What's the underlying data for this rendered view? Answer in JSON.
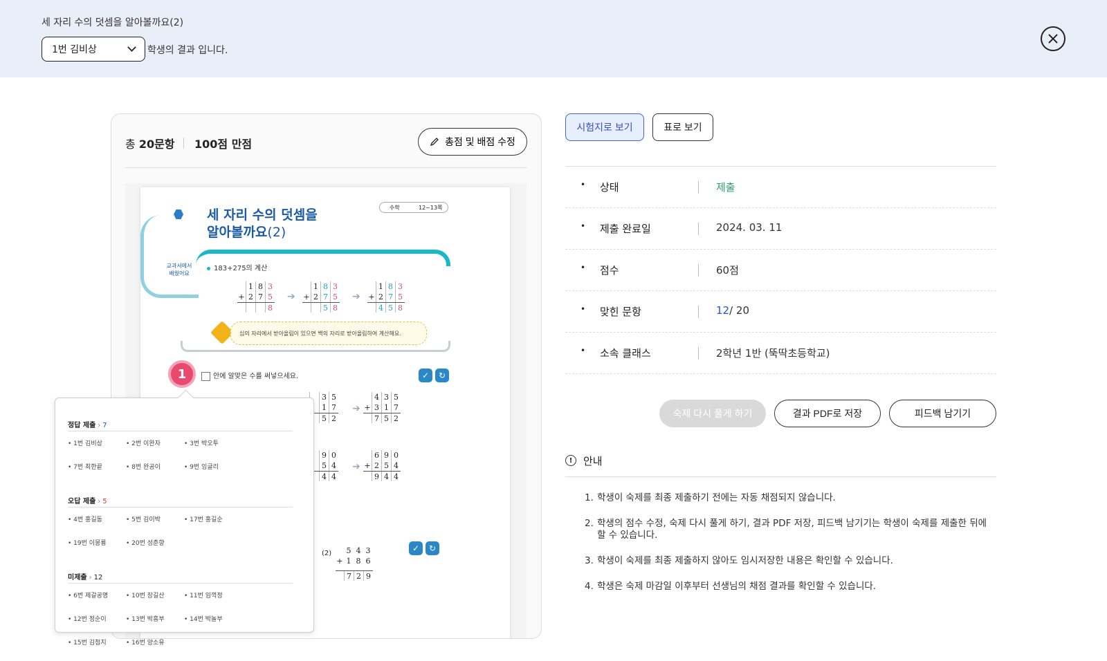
{
  "header": {
    "title": "세 자리 수의 덧셈을 알아볼까요(2)",
    "selected_student": "1번 김비상",
    "result_suffix": "학생의 결과 입니다."
  },
  "summary": {
    "total_prefix": "총 ",
    "total_count": "20문항",
    "full_score": "100점 만점",
    "edit_button": "총점 및 배점 수정"
  },
  "worksheet": {
    "title_line1": "세 자리 수의 덧셈을",
    "title_line2": "알아볼까요",
    "title_paren": "(2)",
    "subject": "수학",
    "pages": "12~13쪽",
    "textbook_label": "교과서에서 배웠어요",
    "calc_label": "183+275의 계산",
    "tip": "십의 자리에서 받아올림이 있으면 백의 자리로 받아올림하여 계산해요.",
    "question_number": "1",
    "question_text": "안에 알맞은 수를 써넣으세요.",
    "sub_label": "(2)"
  },
  "popup": {
    "correct": {
      "label": "정답 제출",
      "count": "7",
      "students": [
        "1번 김비상",
        "2번 이완자",
        "3번 박오투",
        "7번 최한끝",
        "8번 완공이",
        "9번 잉글리"
      ]
    },
    "wrong": {
      "label": "오답 제출",
      "count": "5",
      "students": [
        "4번 홍길동",
        "5번 김이박",
        "17번 홍길순",
        "19번 이몽룡",
        "20번 성춘향"
      ]
    },
    "unsubmitted": {
      "label": "미제출",
      "count": "12",
      "students": [
        "6번 제갈공명",
        "10번 장길산",
        "11번 임꺽정",
        "12번 정순이",
        "13번 박흥부",
        "14번 박놀부",
        "15번 김첨지",
        "16번 양소유"
      ]
    }
  },
  "views": {
    "paper_view": "시험지로 보기",
    "table_view": "표로 보기"
  },
  "info": {
    "status_label": "상태",
    "status_value": "제출",
    "date_label": "제출 완료일",
    "date_value": "2024. 03. 11",
    "score_label": "점수",
    "score_value": "60점",
    "correct_label": "맞힌 문항",
    "correct_value": "12",
    "correct_total": "/ 20",
    "class_label": "소속 클래스",
    "class_value": "2학년 1반 (뚝딱초등학교)"
  },
  "actions": {
    "redo": "숙제 다시 풀게 하기",
    "pdf": "결과 PDF로 저장",
    "feedback": "피드백 남기기"
  },
  "notice": {
    "title": "안내",
    "items": [
      "학생이 숙제를 최종 제출하기 전에는 자동 채점되지 않습니다.",
      "학생의 점수 수정, 숙제 다시 풀게 하기, 결과 PDF 저장, 피드백 남기기는 학생이 숙제를 제출한 뒤에 할 수 있습니다.",
      "학생이 숙제를 최종 제출하지 않아도 임시저장한 내용은 확인할 수 있습니다.",
      "학생은 숙제 마감일 이후부터 선생님의 채점 결과를 확인할 수 있습니다."
    ]
  },
  "colors": {
    "header_bg": "#e9eef8",
    "accent_blue": "#3d63d6",
    "status_green": "#2aa56a",
    "wrong_red": "#e03a3a"
  }
}
